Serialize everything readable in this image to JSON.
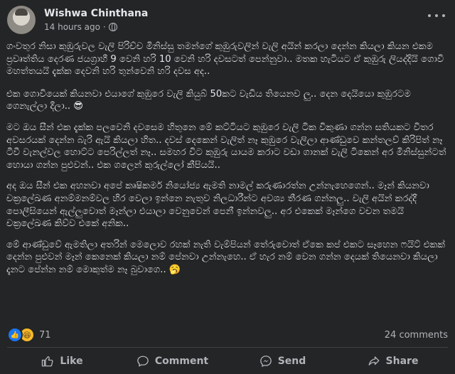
{
  "post": {
    "author": "Wishwa Chinthana",
    "time": "14 hours ago",
    "separator": "·",
    "paragraphs": [
      "ගංවතුර නිසා කුඹුරුවල වැලි පිරිච්ච මිනිස්සු තමන්ගේ කුඹුරුවලින් වැලි අයින් කරලා දෙන්න කියලා කියන එකම ප්‍රවෘත්තිය දෙරණ ජයග්‍රාහී 9 වෙනි හරි 10 වෙනි හරි දවසටත් පෙන්නුවා.. මතක හැටියට ඒ කුඹුරු ලියද්දියි ගොවි මහත්තයයි දැක්ක දෙවනි හරි තුන්වෙනි හරි දවස අද..",
      "එක ගොවියෙක් කියනවා එයාගේ කුඹුරෙ වැලි කියුබ් 50කට වැඩිය තියෙනව ලු.. දෙන දෙයියො කුඹුරටම ගෙනැල්ලා දීලා.. 😎",
      "මට ඔය සීන් එක දැක්ක පලවෙනි දවසෙම හිතුනෙ මේ කට්ටියට කුඹුරෙ වැලි ටික විකුණා ගන්න සතියකට විතර අවසරයක් දෙන්න බැරි ඇයි කියලා හිත.. දවස් දෙකෙන් වැලිත් නෑ කුඹුරෙ වැලිලා ආණ්ඩුවෙ කන්තලව් කිරිපිත් නෑ ටීවී වැනල්වල හොට්ට පෙරිල්ලත් නෑ.. සමහර විට කුඹුරු යායම කරාට වඩා ගානක් වැලි ටිකෙන් අර මිනිස්සුන්ටත් හොයා ගන්න පුළුවන්.. එක ගලෙන් කුරුල්ලෝ කීපියයි..",
      "අද ඔය සීන් එක අහනවා අපේ කෘෂිකර්ම නියෝජ්‍ය ඇමති නාමල් කරුණාරත්න උන්නැහෙගෙන්.. මෑන් කියනවා චක්‍රලේඛණ අනම්මනම්වල හිර වෙලා ඉන්නෙ නැතුව නිලධාරීන්ට අවශ්‍ය තීරණ ගන්නලු.. වැලි අයින් කරද්දී පොලීසියෙන් ඇල්ලුවොත් මෑන්ලා එයාලා වෙනුවෙන් පෙනී ඉන්නවලු.. අර එකෙක් මෑන්ගෙ වචන තමයි චක්‍රලේඛණ කිව්ව එකේ අනික..",
      "මේ ආණ්ඩුවේ ඇමතිලා අතරින් මෙලොව රහක් නැති වැම්පියන් තේරුවොත් ඒකෙ කප් එකට සෑහෙන ෆයිට් එකක් දෙන්න පුළුවන් මෑන් කෙනෙක් කියලා නම් පේනවා උන්නැහෙ.. ඒ හැර නම් වෙන ගන්න දෙයක් තියෙනවා කියලා දැනට පේන්න නම් මොකුත්ම නෑ බුවාගෙ.. 🥱"
    ]
  },
  "reactions": {
    "count": "71",
    "icons": [
      "like-icon",
      "haha-icon"
    ]
  },
  "comments_count": "24 comments",
  "actions": {
    "like": "Like",
    "comment": "Comment",
    "send": "Send",
    "share": "Share"
  },
  "colors": {
    "background": "#242526",
    "text": "#e4e6eb",
    "muted": "#b0b3b8",
    "like_blue": "#1877f2",
    "haha_yellow": "#f7b928"
  }
}
